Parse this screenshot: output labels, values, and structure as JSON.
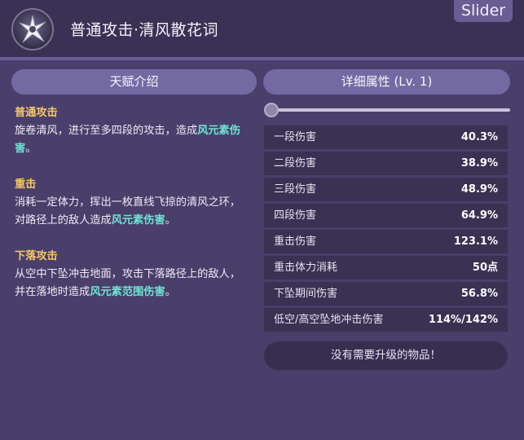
{
  "header": {
    "title": "普通攻击·清风散花词",
    "badge": "Slider",
    "icon": "star-burst-icon"
  },
  "tabs": {
    "talent_intro": "天赋介绍",
    "details": "详细属性 (Lv. 1)"
  },
  "description": {
    "normal_attack": {
      "title": "普通攻击",
      "text_before": "旋卷清风，进行至多四段的攻击，造成",
      "highlight": "风元素伤害",
      "text_after": "。"
    },
    "charged_attack": {
      "title": "重击",
      "text_before": "消耗一定体力，挥出一枚直线飞掠的清风之环，对路径上的敌人造成",
      "highlight": "风元素伤害",
      "text_after": "。"
    },
    "plunging_attack": {
      "title": "下落攻击",
      "text_before": "从空中下坠冲击地面，攻击下落路径上的敌人，并在落地时造成",
      "highlight": "风元素范围伤害",
      "text_after": "。"
    }
  },
  "level_slider": {
    "value": 1,
    "min": 1,
    "max": 15
  },
  "stats": [
    {
      "name": "一段伤害",
      "value": "40.3%"
    },
    {
      "name": "二段伤害",
      "value": "38.9%"
    },
    {
      "name": "三段伤害",
      "value": "48.9%"
    },
    {
      "name": "四段伤害",
      "value": "64.9%"
    },
    {
      "name": "重击伤害",
      "value": "123.1%"
    },
    {
      "name": "重击体力消耗",
      "value": "50点"
    },
    {
      "name": "下坠期间伤害",
      "value": "56.8%"
    },
    {
      "name": "低空/高空坠地冲击伤害",
      "value": "114%/142%"
    }
  ],
  "upgrade_message": "没有需要升级的物品！",
  "colors": {
    "background": "#4a3f6b",
    "header": "#3b3155",
    "tab": "#746aa3",
    "section_title": "#f4c66a",
    "element_highlight": "#6ee2d3"
  }
}
